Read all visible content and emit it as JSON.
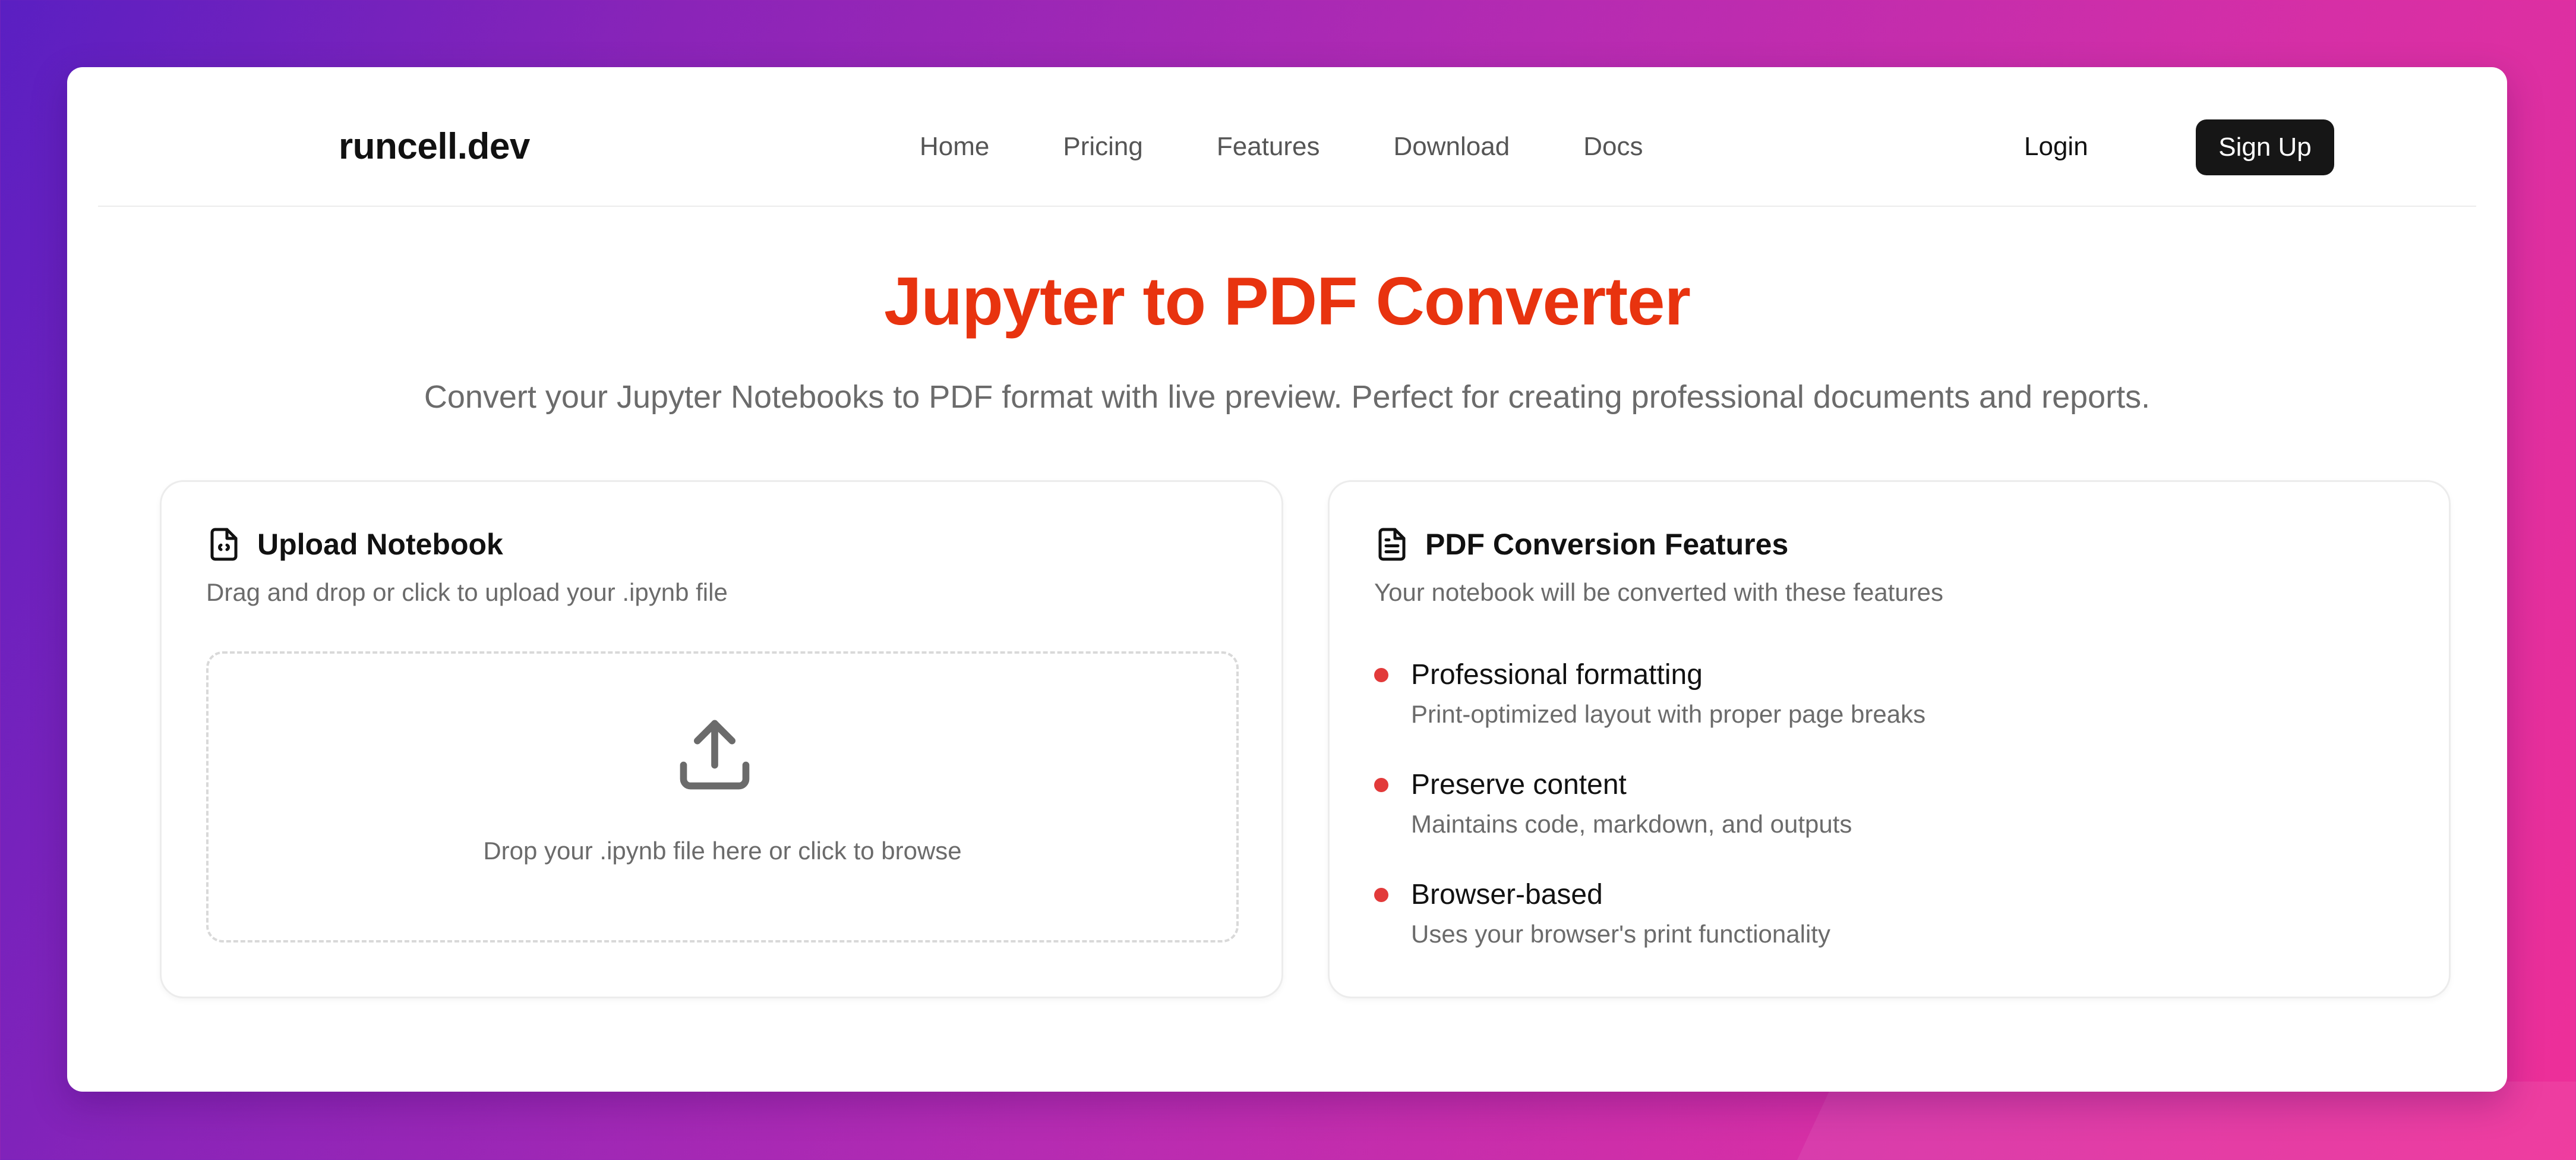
{
  "header": {
    "logo": "runcell.dev",
    "nav": [
      "Home",
      "Pricing",
      "Features",
      "Download",
      "Docs"
    ],
    "login_label": "Login",
    "signup_label": "Sign Up"
  },
  "hero": {
    "title": "Jupyter to PDF Converter",
    "subtitle": "Convert your Jupyter Notebooks to PDF format with live preview. Perfect for creating professional documents and reports."
  },
  "upload_panel": {
    "icon": "file-code-icon",
    "title": "Upload Notebook",
    "description": "Drag and drop or click to upload your .ipynb file",
    "dropzone_icon": "upload-icon",
    "dropzone_text": "Drop your .ipynb file here or click to browse"
  },
  "features_panel": {
    "icon": "file-text-icon",
    "title": "PDF Conversion Features",
    "description": "Your notebook will be converted with these features",
    "bullet_color": "#e23a3a",
    "items": [
      {
        "title": "Professional formatting",
        "description": "Print-optimized layout with proper page breaks"
      },
      {
        "title": "Preserve content",
        "description": "Maintains code, markdown, and outputs"
      },
      {
        "title": "Browser-based",
        "description": "Uses your browser's print functionality"
      }
    ]
  },
  "colors": {
    "accent": "#e8330f",
    "button_dark": "#161616"
  }
}
